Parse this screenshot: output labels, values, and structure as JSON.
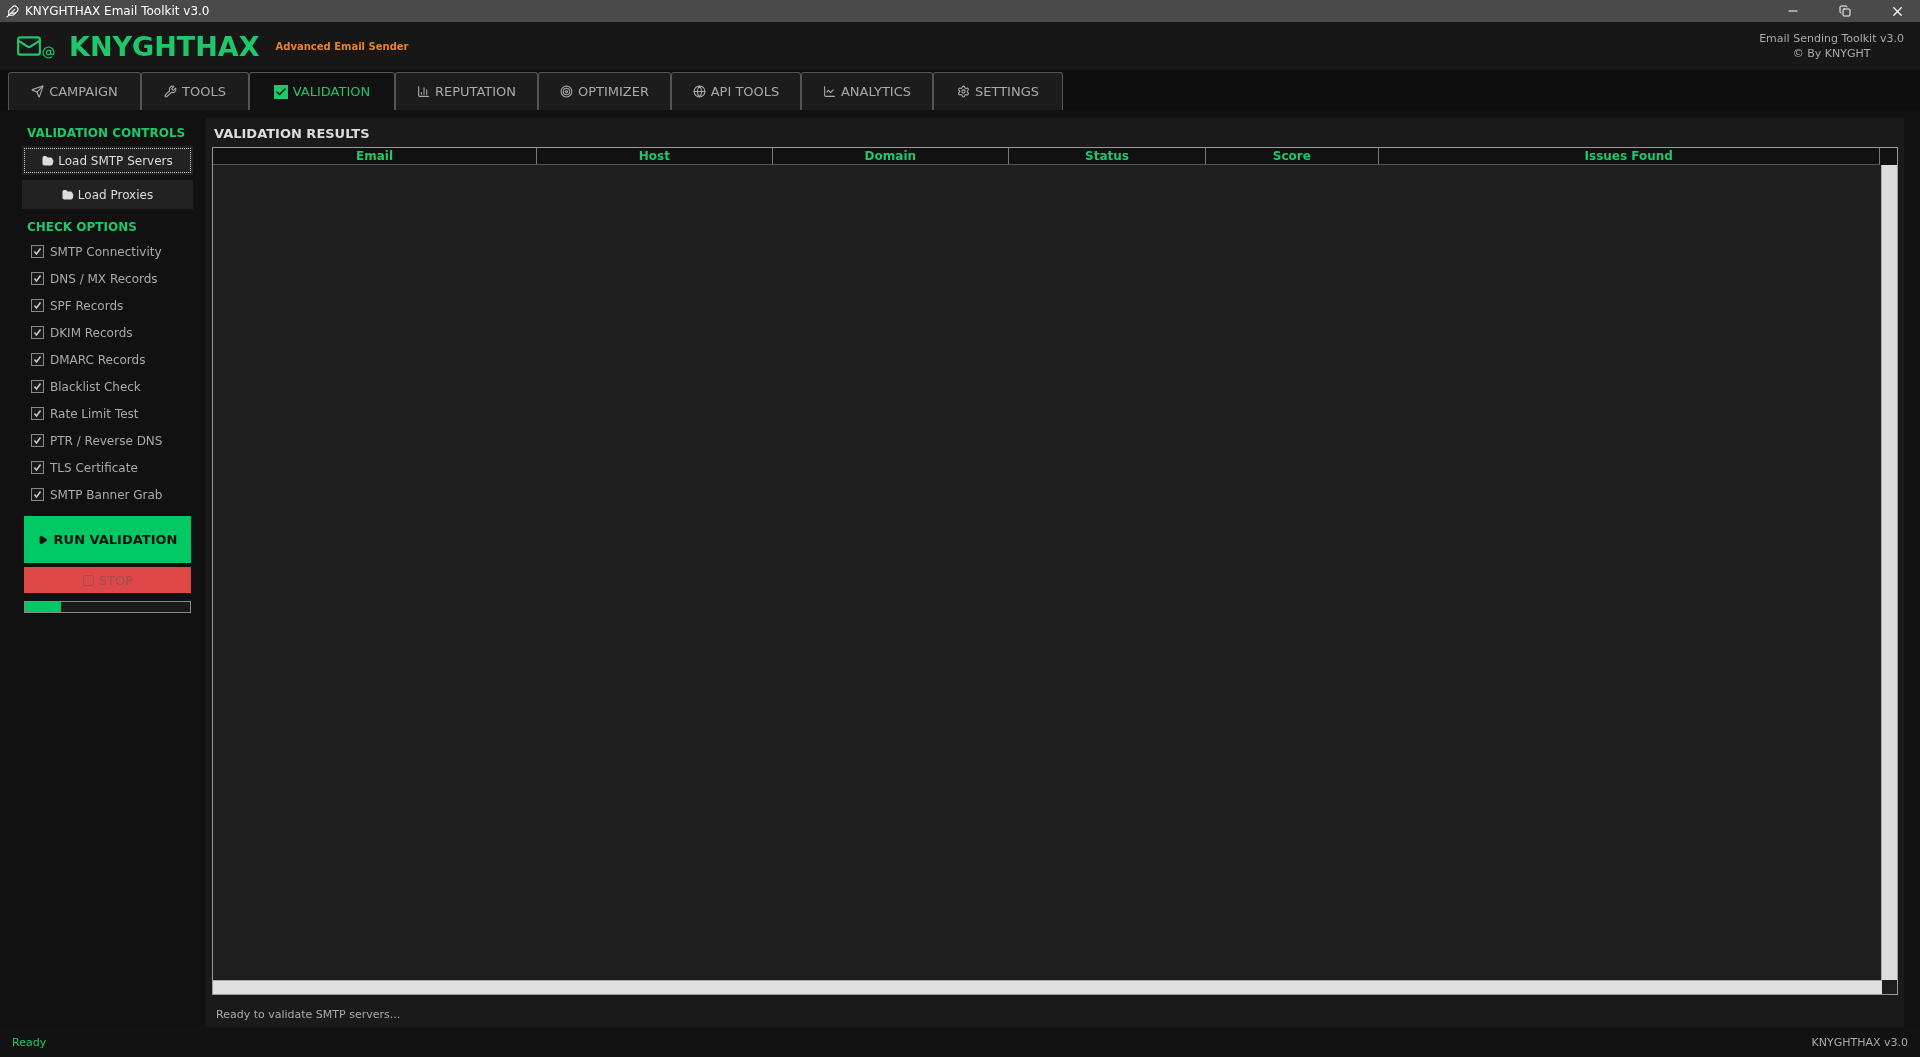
{
  "window": {
    "title": "KNYGHTHAX Email Toolkit v3.0"
  },
  "header": {
    "brand": "KNYGHTHAX",
    "subtitle": "Advanced Email Sender",
    "version_line": "Email Sending Toolkit v3.0",
    "credit": "© By KNYGHT"
  },
  "tabs": [
    {
      "label": "CAMPAIGN",
      "selected": false
    },
    {
      "label": "TOOLS",
      "selected": false
    },
    {
      "label": "VALIDATION",
      "selected": true
    },
    {
      "label": "REPUTATION",
      "selected": false
    },
    {
      "label": "OPTIMIZER",
      "selected": false
    },
    {
      "label": "API TOOLS",
      "selected": false
    },
    {
      "label": "ANALYTICS",
      "selected": false
    },
    {
      "label": "SETTINGS",
      "selected": false
    }
  ],
  "sidebar": {
    "controls_title": "VALIDATION CONTROLS",
    "load_buttons": [
      {
        "label": "Load SMTP Servers",
        "focused": true
      },
      {
        "label": "Load Proxies",
        "focused": false
      }
    ],
    "options_title": "CHECK OPTIONS",
    "options": [
      {
        "label": "SMTP Connectivity",
        "checked": true
      },
      {
        "label": "DNS / MX Records",
        "checked": true
      },
      {
        "label": "SPF Records",
        "checked": true
      },
      {
        "label": "DKIM Records",
        "checked": true
      },
      {
        "label": "DMARC Records",
        "checked": true
      },
      {
        "label": "Blacklist Check",
        "checked": true
      },
      {
        "label": "Rate Limit Test",
        "checked": true
      },
      {
        "label": "PTR / Reverse DNS",
        "checked": true
      },
      {
        "label": "TLS Certificate",
        "checked": true
      },
      {
        "label": "SMTP Banner Grab",
        "checked": true
      }
    ],
    "run_button": "RUN VALIDATION",
    "stop_button": {
      "label": "STOP",
      "disabled": true
    },
    "progress": {
      "level": 0.22
    }
  },
  "results": {
    "title": "VALIDATION RESULTS",
    "columns": [
      "Email",
      "Host",
      "Domain",
      "Status",
      "Score",
      "Issues Found"
    ],
    "message": "Ready to validate SMTP servers..."
  },
  "status_bar": {
    "left": "Ready",
    "right": "KNYGHTHAX v3.0"
  }
}
